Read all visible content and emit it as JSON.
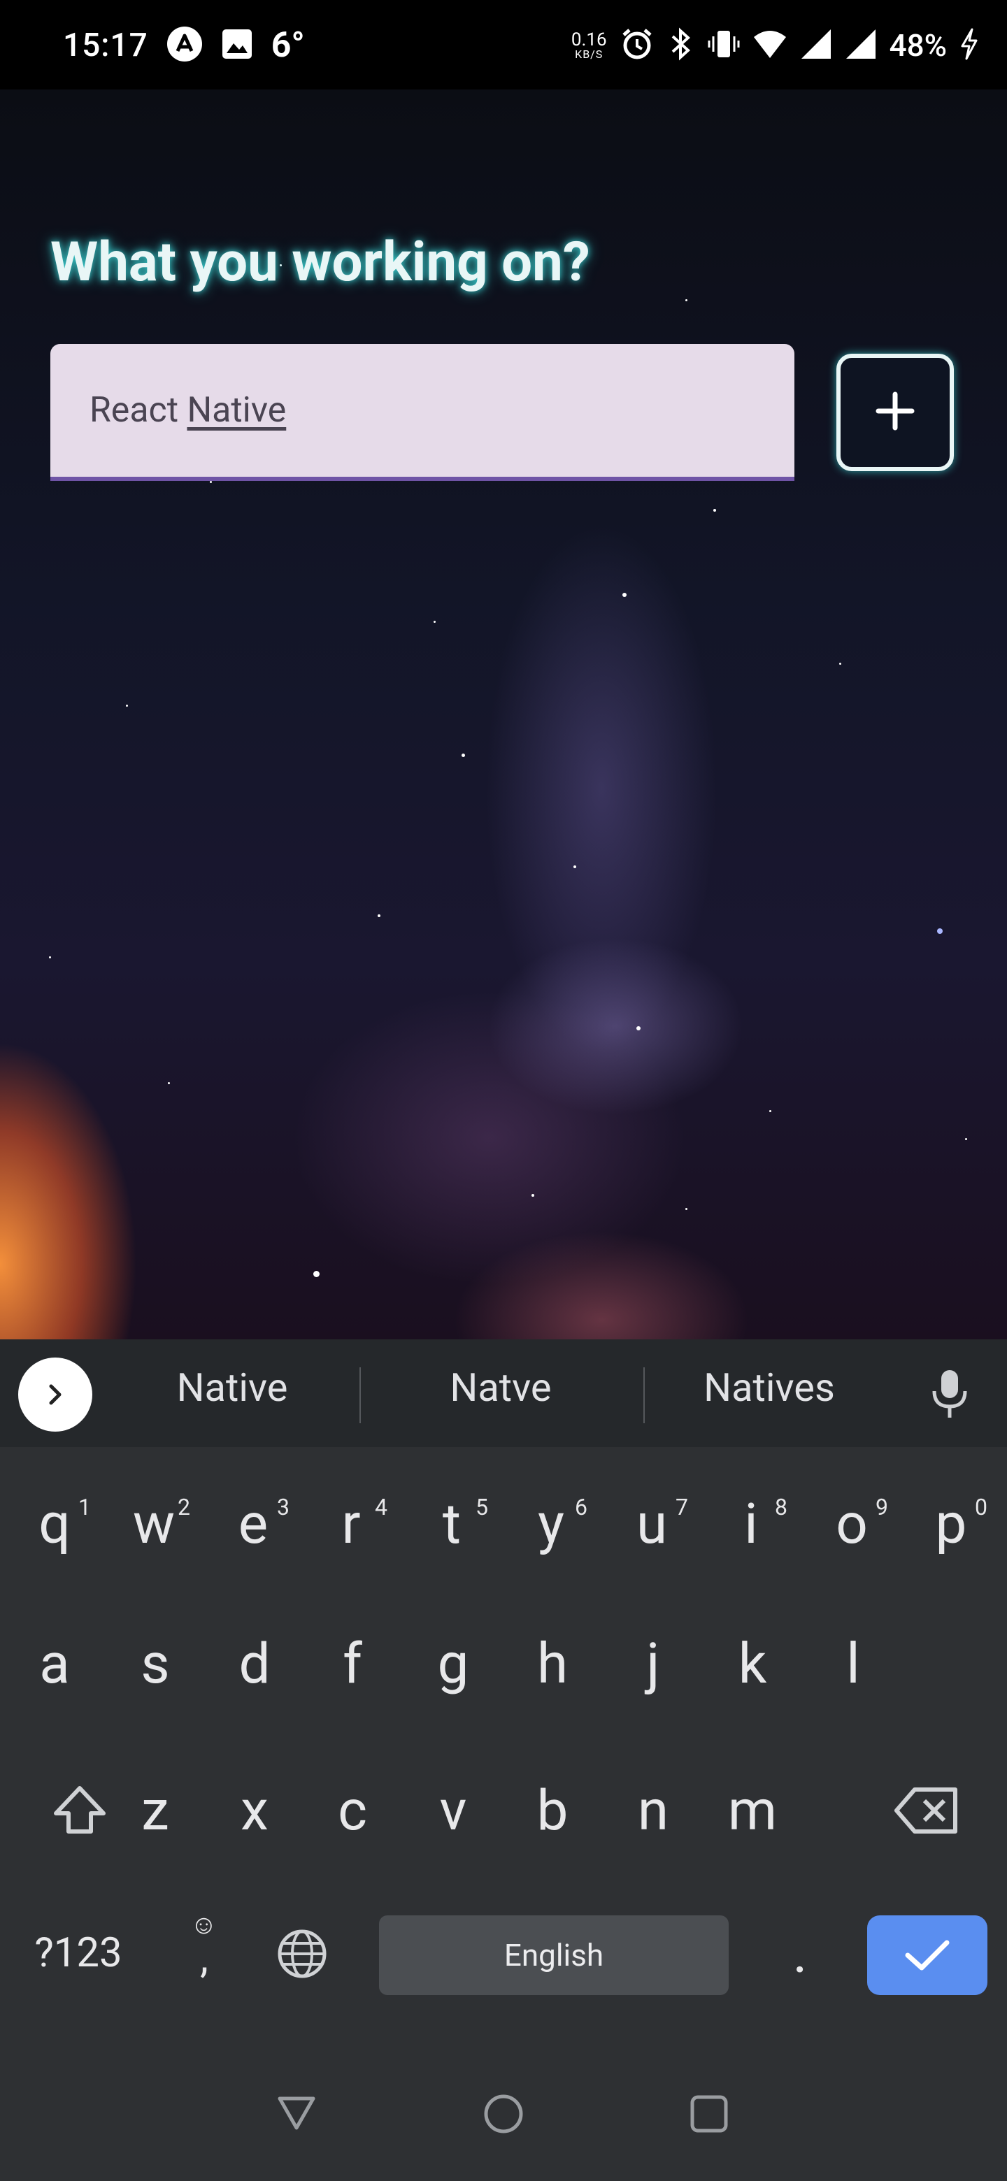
{
  "status_bar": {
    "time": "15:17",
    "temperature": "6°",
    "net_speed_value": "0.16",
    "net_speed_unit": "KB/S",
    "battery": "48%"
  },
  "app": {
    "heading": "What you working on?",
    "input": {
      "value_prefix": "React ",
      "value_underlined": "Native"
    },
    "add_button_icon": "plus-icon"
  },
  "keyboard": {
    "suggestions": [
      "Native",
      "Natve",
      "Natives"
    ],
    "row1": [
      {
        "k": "q",
        "n": "1"
      },
      {
        "k": "w",
        "n": "2"
      },
      {
        "k": "e",
        "n": "3"
      },
      {
        "k": "r",
        "n": "4"
      },
      {
        "k": "t",
        "n": "5"
      },
      {
        "k": "y",
        "n": "6"
      },
      {
        "k": "u",
        "n": "7"
      },
      {
        "k": "i",
        "n": "8"
      },
      {
        "k": "o",
        "n": "9"
      },
      {
        "k": "p",
        "n": "0"
      }
    ],
    "row2": [
      "a",
      "s",
      "d",
      "f",
      "g",
      "h",
      "j",
      "k",
      "l"
    ],
    "row3": [
      "z",
      "x",
      "c",
      "v",
      "b",
      "n",
      "m"
    ],
    "symbols_label": "?123",
    "comma_label": ",",
    "period_label": ".",
    "space_label": "English"
  },
  "colors": {
    "accent": "#6f54a6",
    "glow": "#3cdcdc",
    "enter_key": "#5a8ef0"
  }
}
